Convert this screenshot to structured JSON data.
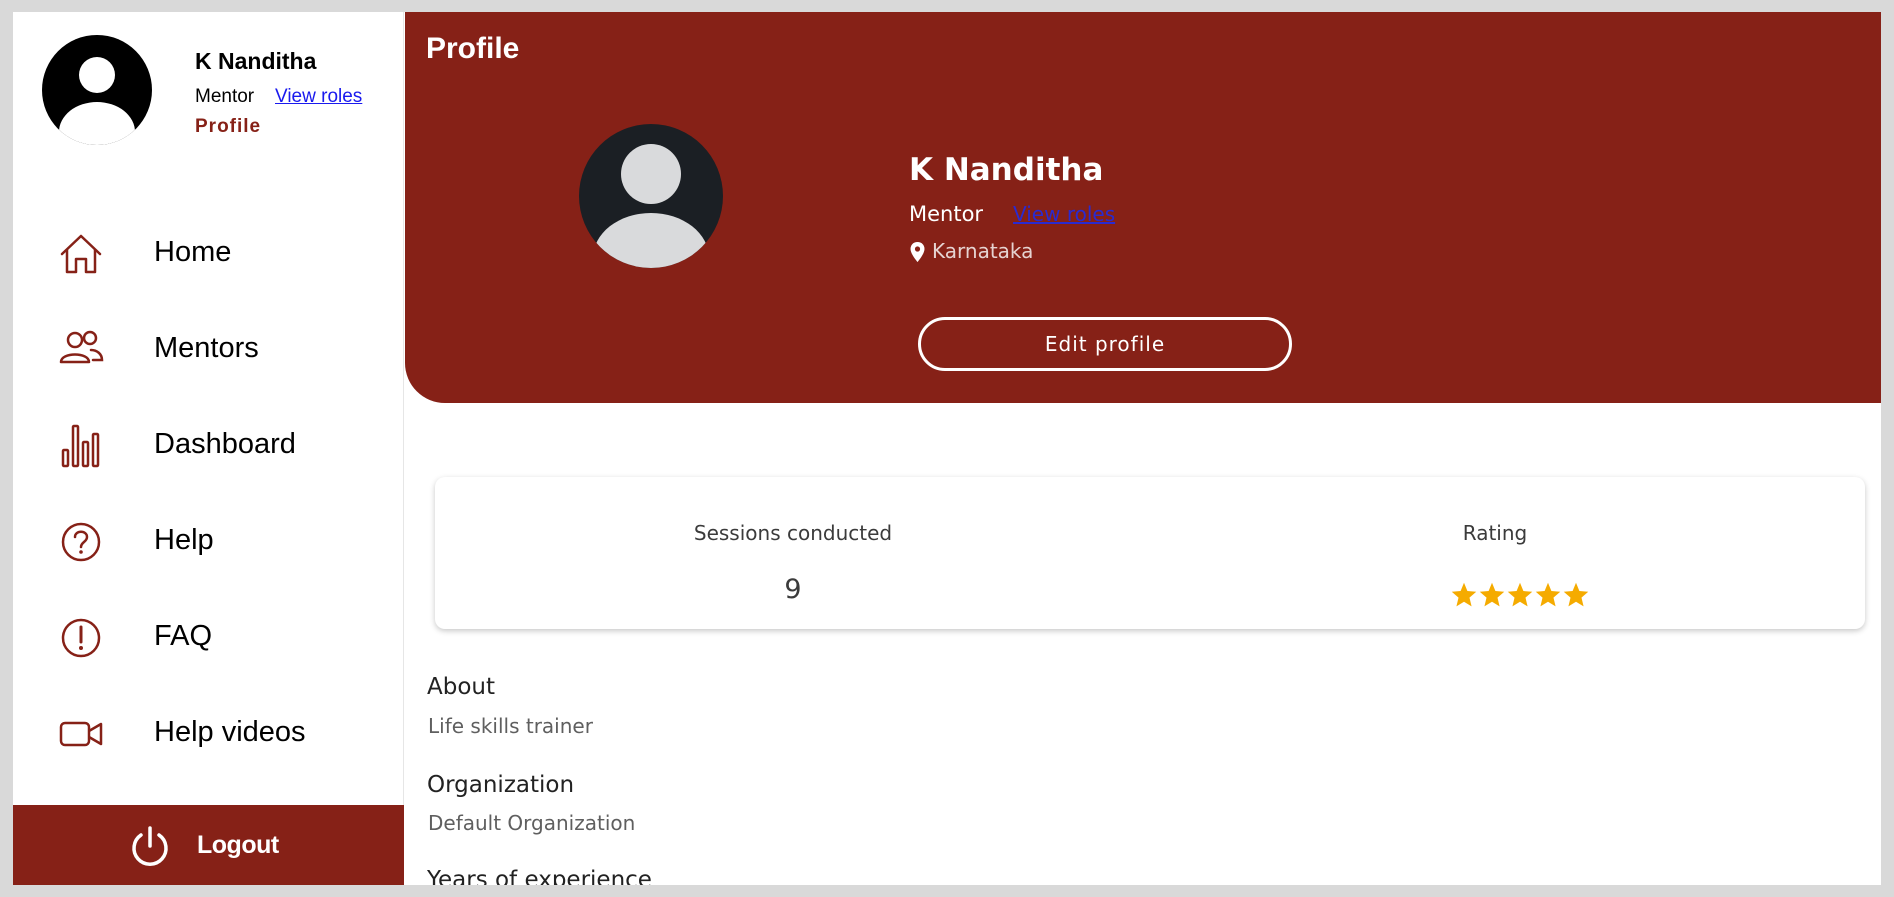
{
  "colors": {
    "brand": "#862117",
    "star": "#f5ab00",
    "link": "#1a1aee"
  },
  "sidebar": {
    "user_name": "K Nanditha",
    "role": "Mentor",
    "view_roles": "View roles",
    "profile_link": "Profile",
    "items": [
      {
        "label": "Home",
        "icon": "home-icon"
      },
      {
        "label": "Mentors",
        "icon": "users-icon"
      },
      {
        "label": "Dashboard",
        "icon": "bar-chart-icon"
      },
      {
        "label": "Help",
        "icon": "help-circle-icon"
      },
      {
        "label": "FAQ",
        "icon": "alert-circle-icon"
      },
      {
        "label": "Help videos",
        "icon": "video-icon"
      }
    ],
    "logout": "Logout"
  },
  "profile": {
    "page_title": "Profile",
    "name": "K Nanditha",
    "role": "Mentor",
    "view_roles": "View roles",
    "location": "Karnataka",
    "edit_button": "Edit profile"
  },
  "stats": {
    "sessions_label": "Sessions conducted",
    "sessions_value": "9",
    "rating_label": "Rating",
    "rating_value": 5,
    "rating_max": 5
  },
  "details": {
    "about_title": "About",
    "about_value": "Life skills trainer",
    "organization_title": "Organization",
    "organization_value": "Default Organization",
    "experience_title": "Years of experience"
  }
}
